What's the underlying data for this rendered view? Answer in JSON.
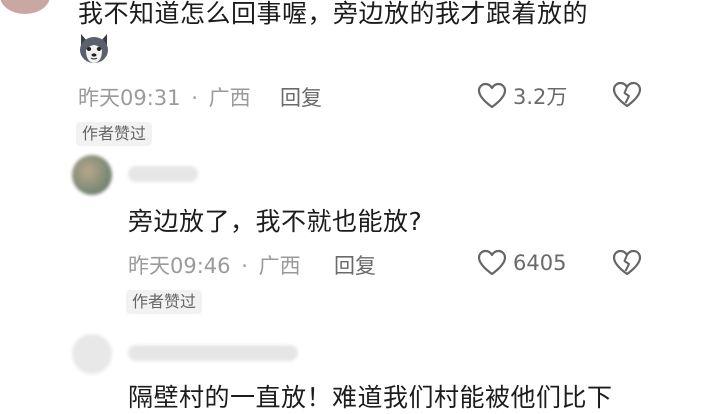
{
  "comment1": {
    "text": "我不知道怎么回事喔，旁边放的我才跟着放的",
    "time": "昨天09:31",
    "location": "广西",
    "reply_label": "回复",
    "likes": "3.2万",
    "badge": "作者赞过"
  },
  "comment2": {
    "text": "旁边放了，我不就也能放?",
    "time": "昨天09:46",
    "location": "广西",
    "reply_label": "回复",
    "likes": "6405",
    "badge": "作者赞过"
  },
  "comment3": {
    "text": "隔壁村的一直放！难道我们村能被他们比下"
  },
  "icons": {
    "like": "heart-outline-icon",
    "dislike": "broken-heart-icon",
    "emoji": "husky-emoji"
  },
  "colors": {
    "text": "#1c1c1c",
    "meta": "#9a9a9a",
    "badge_bg": "#f2f2f2"
  }
}
